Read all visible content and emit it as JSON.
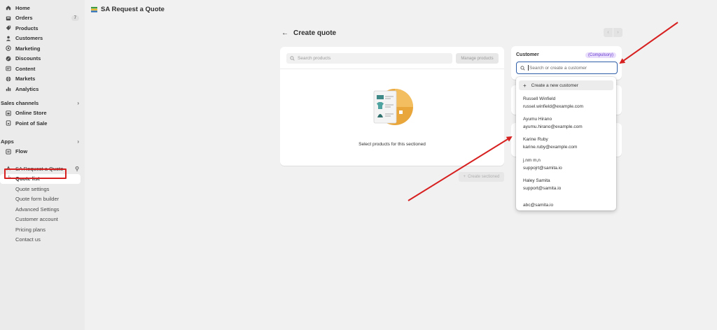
{
  "sidebar": {
    "items": [
      {
        "label": "Home",
        "icon": "home-icon"
      },
      {
        "label": "Orders",
        "icon": "orders-icon",
        "badge": "7"
      },
      {
        "label": "Products",
        "icon": "tag-icon"
      },
      {
        "label": "Customers",
        "icon": "person-icon"
      },
      {
        "label": "Marketing",
        "icon": "target-icon"
      },
      {
        "label": "Discounts",
        "icon": "discount-icon"
      },
      {
        "label": "Content",
        "icon": "content-icon"
      },
      {
        "label": "Markets",
        "icon": "globe-icon"
      },
      {
        "label": "Analytics",
        "icon": "chart-icon"
      }
    ],
    "sales_channels_label": "Sales channels",
    "sales_channels": [
      {
        "label": "Online Store",
        "icon": "store-icon"
      },
      {
        "label": "Point of Sale",
        "icon": "pos-icon"
      }
    ],
    "apps_label": "Apps",
    "apps": [
      {
        "label": "Flow",
        "icon": "flow-icon"
      }
    ],
    "app_name": "SA Request a Quote",
    "app_subitems": [
      "Quote list",
      "Quote settings",
      "Quote form builder",
      "Advanced Settings",
      "Customer account",
      "Pricing plans",
      "Contact us"
    ]
  },
  "header": {
    "app_title": "SA Request a Quote"
  },
  "main": {
    "page_title": "Create quote",
    "search_products_placeholder": "Search products",
    "manage_products_label": "Manage products",
    "empty_text": "Select products for this sectioned",
    "create_button_label": "Create sectioned"
  },
  "customer": {
    "label": "Customer",
    "compulsory_badge": "(Compulsory)",
    "search_placeholder": "Search or create a customer",
    "create_new_label": "Create a new customer",
    "options": [
      {
        "name": "Russell Winfield",
        "email": "russel.winfield@example.com"
      },
      {
        "name": "Ayumu Hirano",
        "email": "ayumu.hirano@example.com"
      },
      {
        "name": "Karine Ruby",
        "email": "karine.ruby@example.com"
      },
      {
        "name": "j.nm m,n",
        "email": "suppojrt@samita.io"
      },
      {
        "name": "Haley Samita",
        "email": "support@samita.io"
      },
      {
        "name": "",
        "email": "abc@samita.io"
      }
    ]
  },
  "colors": {
    "highlight_red": "#d72020",
    "focus_blue": "#2f5ea8",
    "compulsory_bg": "#e9defc",
    "compulsory_text": "#6b3fd1"
  }
}
